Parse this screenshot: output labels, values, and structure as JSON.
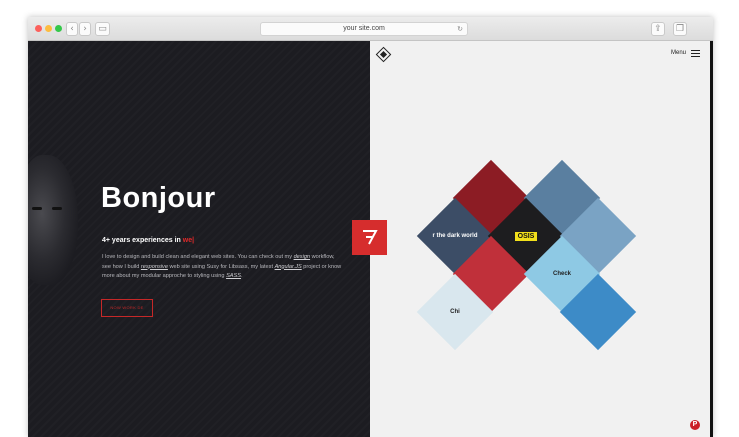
{
  "browser": {
    "url": "your site.com"
  },
  "hero": {
    "title": "Bonjour",
    "subtitle_prefix": "4+ years experiences in ",
    "subtitle_accent": "we|",
    "text_1": "I love to design and build clean and elegant web sites. You can check out my ",
    "link_design": "design",
    "text_2": " workflow, see how I build ",
    "link_responsive": "responsive",
    "text_3": " web site using Susy for Libsass, my latest ",
    "link_angular": "Angular.JS",
    "text_4": " project or know more about my modular approche to styling using ",
    "link_sass": "SASS",
    "text_5": ".",
    "button_label": "NOW WORK DE"
  },
  "nav": {
    "menu_label": "Menu"
  },
  "portfolio": {
    "tiles": [
      {
        "label": "",
        "color": "#8c1c24"
      },
      {
        "label": "",
        "color": "#5a7fa0"
      },
      {
        "label": "r the dark world",
        "color": "#3c4d66"
      },
      {
        "label": "OSIS",
        "color": "#1d1d1f"
      },
      {
        "label": "",
        "color": "#7aa3c4"
      },
      {
        "label": "",
        "color": "#c0303a"
      },
      {
        "label": "Check",
        "color": "#8ec9e4"
      },
      {
        "label": "Chi",
        "color": "#d9e7ee"
      },
      {
        "label": "",
        "color": "#3d8bc7"
      }
    ]
  },
  "colors": {
    "accent": "#d62d2d",
    "dark_bg": "#1c1c21",
    "light_bg": "#f1f1f1"
  },
  "icons": [
    "logo-icon",
    "menu-icon",
    "pinterest-icon",
    "brand-badge-icon"
  ]
}
